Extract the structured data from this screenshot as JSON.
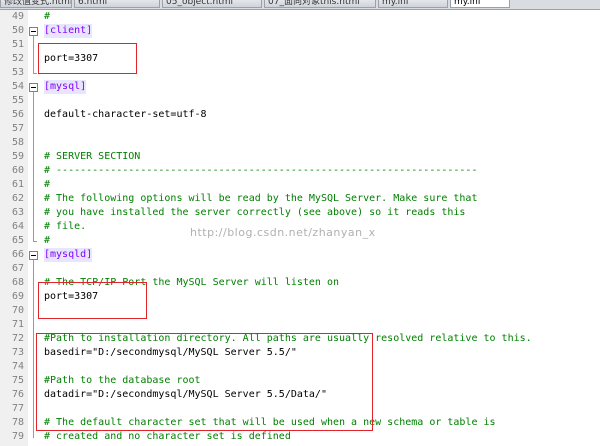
{
  "tabs": [
    {
      "label": "修改值变式.html"
    },
    {
      "label": "6.html"
    },
    {
      "label": "05_object.html"
    },
    {
      "label": "07_面向对象this.html"
    },
    {
      "label": "my.ini"
    },
    {
      "label": "my.ini"
    }
  ],
  "lines": [
    {
      "num": "49",
      "text": "#",
      "kind": "comment"
    },
    {
      "num": "50",
      "text": "[client]",
      "kind": "section"
    },
    {
      "num": "51",
      "text": "",
      "kind": "plain"
    },
    {
      "num": "52",
      "text": "port=3307",
      "kind": "plain"
    },
    {
      "num": "53",
      "text": "",
      "kind": "plain"
    },
    {
      "num": "54",
      "text": "[mysql]",
      "kind": "section"
    },
    {
      "num": "55",
      "text": "",
      "kind": "plain"
    },
    {
      "num": "56",
      "text": "default-character-set=utf-8",
      "kind": "plain"
    },
    {
      "num": "57",
      "text": "",
      "kind": "plain"
    },
    {
      "num": "58",
      "text": "",
      "kind": "plain"
    },
    {
      "num": "59",
      "text": "# SERVER SECTION",
      "kind": "comment"
    },
    {
      "num": "60",
      "text": "# ----------------------------------------------------------------------",
      "kind": "comment"
    },
    {
      "num": "61",
      "text": "#",
      "kind": "comment"
    },
    {
      "num": "62",
      "text": "# The following options will be read by the MySQL Server. Make sure that",
      "kind": "comment"
    },
    {
      "num": "63",
      "text": "# you have installed the server correctly (see above) so it reads this",
      "kind": "comment"
    },
    {
      "num": "64",
      "text": "# file.",
      "kind": "comment"
    },
    {
      "num": "65",
      "text": "#",
      "kind": "comment"
    },
    {
      "num": "66",
      "text": "[mysqld]",
      "kind": "section"
    },
    {
      "num": "67",
      "text": "",
      "kind": "plain"
    },
    {
      "num": "68",
      "text": "# The TCP/IP Port the MySQL Server will listen on",
      "kind": "comment"
    },
    {
      "num": "69",
      "text": "port=3307",
      "kind": "plain"
    },
    {
      "num": "70",
      "text": "",
      "kind": "plain"
    },
    {
      "num": "71",
      "text": "",
      "kind": "plain"
    },
    {
      "num": "72",
      "text": "#Path to installation directory. All paths are usually resolved relative to this.",
      "kind": "comment"
    },
    {
      "num": "73",
      "text": "basedir=\"D:/secondmysql/MySQL Server 5.5/\"",
      "kind": "plain"
    },
    {
      "num": "74",
      "text": "",
      "kind": "plain"
    },
    {
      "num": "75",
      "text": "#Path to the database root",
      "kind": "comment"
    },
    {
      "num": "76",
      "text": "datadir=\"D:/secondmysql/MySQL Server 5.5/Data/\"",
      "kind": "plain"
    },
    {
      "num": "77",
      "text": "",
      "kind": "plain"
    },
    {
      "num": "78",
      "text": "# The default character set that will be used when a new schema or table is",
      "kind": "comment"
    },
    {
      "num": "79",
      "text": "# created and no character set is defined",
      "kind": "comment"
    }
  ],
  "watermark": "http://blog.csdn.net/zhanyan_x"
}
